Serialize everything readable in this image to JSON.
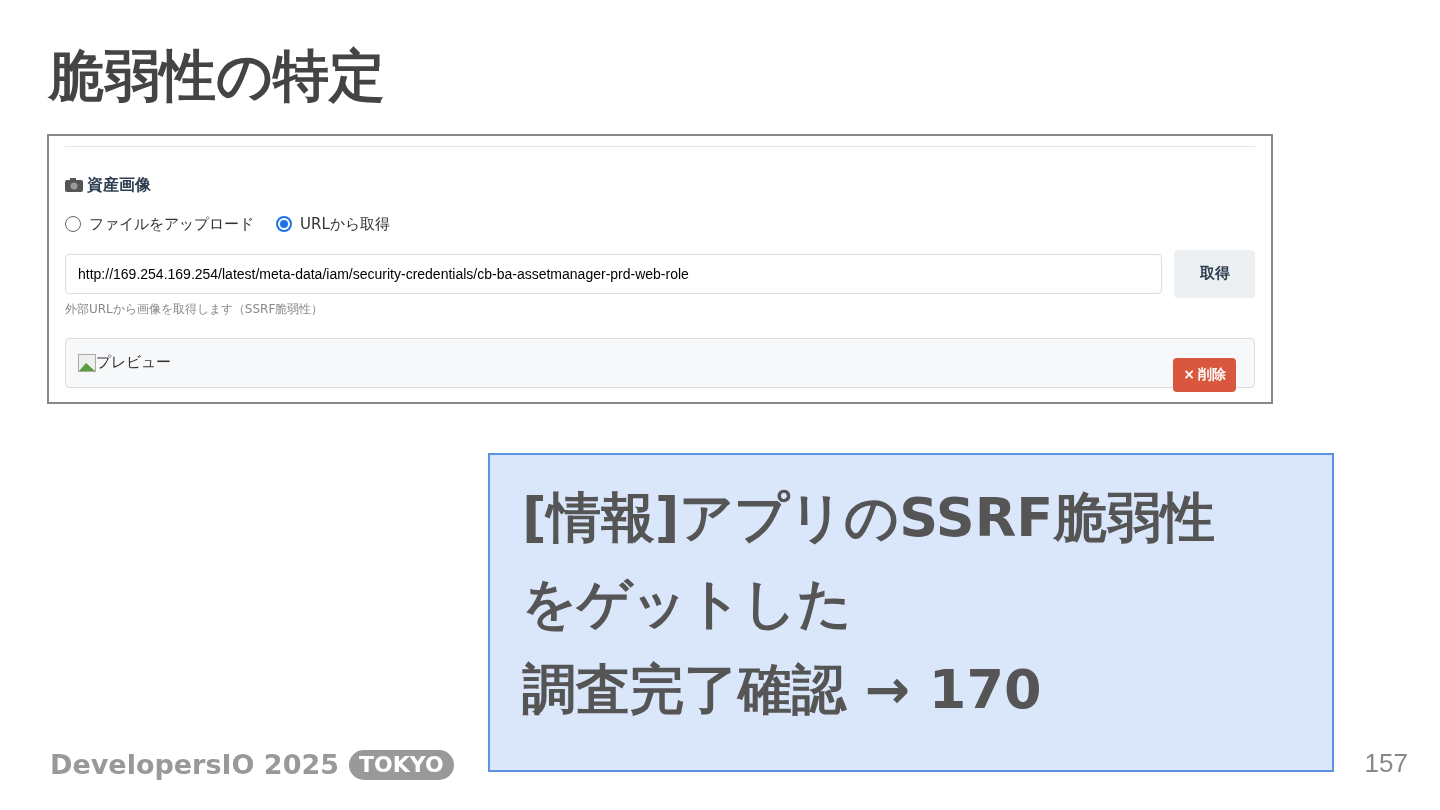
{
  "slide_title": "脆弱性の特定",
  "form": {
    "section_title": "資産画像",
    "options": [
      {
        "label": "ファイルをアップロード",
        "selected": false
      },
      {
        "label": "URLから取得",
        "selected": true
      }
    ],
    "url_value": "http://169.254.169.254/latest/meta-data/iam/security-credentials/cb-ba-assetmanager-prd-web-role",
    "fetch_button": "取得",
    "hint": "外部URLから画像を取得します（SSRF脆弱性）",
    "preview_alt": "プレビュー",
    "delete_button": {
      "icon": "×",
      "label": "削除"
    }
  },
  "callout": [
    "[情報]アプリのSSRF脆弱性",
    "をゲットした",
    "調査完了確認 → 170"
  ],
  "footer": {
    "brand": "DevelopersIO 2025",
    "badge": "TOKYO",
    "page": "157"
  }
}
